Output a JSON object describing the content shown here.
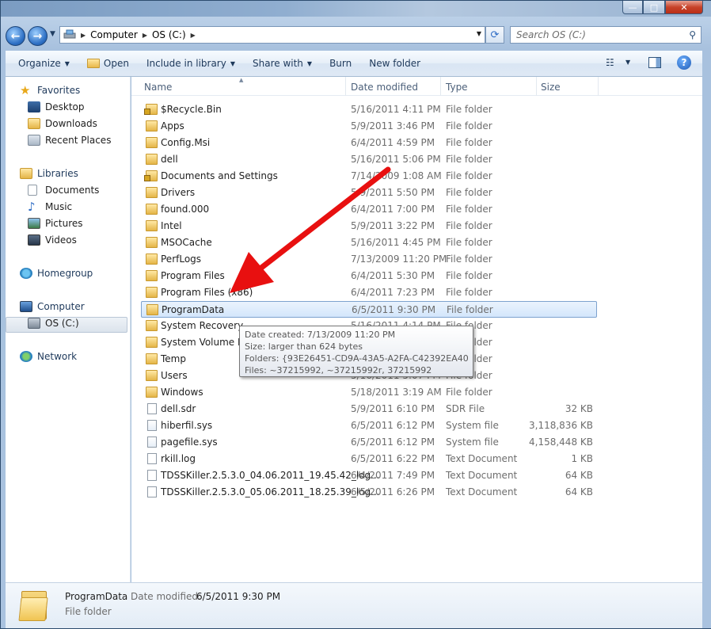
{
  "window": {
    "caption_buttons": {
      "minimize": "—",
      "maximize": "□",
      "close": "✕"
    }
  },
  "nav": {
    "back_icon": "back-arrow-icon",
    "forward_icon": "forward-arrow-icon",
    "address": {
      "segments": [
        "Computer",
        "OS (C:)"
      ]
    },
    "search": {
      "placeholder": "Search OS (C:)"
    }
  },
  "toolbar": {
    "organize": "Organize",
    "open": "Open",
    "include": "Include in library",
    "share": "Share with",
    "burn": "Burn",
    "new_folder": "New folder"
  },
  "sidebar": {
    "favorites": "Favorites",
    "desktop": "Desktop",
    "downloads": "Downloads",
    "recent": "Recent Places",
    "libraries": "Libraries",
    "documents": "Documents",
    "music": "Music",
    "pictures": "Pictures",
    "videos": "Videos",
    "homegroup": "Homegroup",
    "computer": "Computer",
    "os": "OS (C:)",
    "network": "Network"
  },
  "columns": {
    "name": "Name",
    "date": "Date modified",
    "type": "Type",
    "size": "Size"
  },
  "files": [
    {
      "name": "$Recycle.Bin",
      "date": "5/16/2011 4:11 PM",
      "type": "File folder",
      "size": "",
      "icon": "lockfolder"
    },
    {
      "name": "Apps",
      "date": "5/9/2011 3:46 PM",
      "type": "File folder",
      "size": "",
      "icon": "folder"
    },
    {
      "name": "Config.Msi",
      "date": "6/4/2011 4:59 PM",
      "type": "File folder",
      "size": "",
      "icon": "folder"
    },
    {
      "name": "dell",
      "date": "5/16/2011 5:06 PM",
      "type": "File folder",
      "size": "",
      "icon": "folder"
    },
    {
      "name": "Documents and Settings",
      "date": "7/14/2009 1:08 AM",
      "type": "File folder",
      "size": "",
      "icon": "lockfolder"
    },
    {
      "name": "Drivers",
      "date": "5/9/2011 5:50 PM",
      "type": "File folder",
      "size": "",
      "icon": "folder"
    },
    {
      "name": "found.000",
      "date": "6/4/2011 7:00 PM",
      "type": "File folder",
      "size": "",
      "icon": "folder"
    },
    {
      "name": "Intel",
      "date": "5/9/2011 3:22 PM",
      "type": "File folder",
      "size": "",
      "icon": "folder"
    },
    {
      "name": "MSOCache",
      "date": "5/16/2011 4:45 PM",
      "type": "File folder",
      "size": "",
      "icon": "folder"
    },
    {
      "name": "PerfLogs",
      "date": "7/13/2009 11:20 PM",
      "type": "File folder",
      "size": "",
      "icon": "folder"
    },
    {
      "name": "Program Files",
      "date": "6/4/2011 5:30 PM",
      "type": "File folder",
      "size": "",
      "icon": "folder"
    },
    {
      "name": "Program Files (x86)",
      "date": "6/4/2011 7:23 PM",
      "type": "File folder",
      "size": "",
      "icon": "folder"
    },
    {
      "name": "ProgramData",
      "date": "6/5/2011 9:30 PM",
      "type": "File folder",
      "size": "",
      "icon": "folder",
      "selected": true
    },
    {
      "name": "System Recovery",
      "date": "5/16/2011 4:14 PM",
      "type": "File folder",
      "size": "",
      "icon": "folder"
    },
    {
      "name": "System Volume Information",
      "date": "6/5/2011 6:11 PM",
      "type": "File folder",
      "size": "",
      "icon": "folder"
    },
    {
      "name": "Temp",
      "date": "6/4/2011 7:01 PM",
      "type": "File folder",
      "size": "",
      "icon": "folder"
    },
    {
      "name": "Users",
      "date": "5/16/2011 5:07 PM",
      "type": "File folder",
      "size": "",
      "icon": "folder"
    },
    {
      "name": "Windows",
      "date": "5/18/2011 3:19 AM",
      "type": "File folder",
      "size": "",
      "icon": "folder"
    },
    {
      "name": "dell.sdr",
      "date": "5/9/2011 6:10 PM",
      "type": "SDR File",
      "size": "32 KB",
      "icon": "file"
    },
    {
      "name": "hiberfil.sys",
      "date": "6/5/2011 6:12 PM",
      "type": "System file",
      "size": "3,118,836 KB",
      "icon": "sysfile"
    },
    {
      "name": "pagefile.sys",
      "date": "6/5/2011 6:12 PM",
      "type": "System file",
      "size": "4,158,448 KB",
      "icon": "sysfile"
    },
    {
      "name": "rkill.log",
      "date": "6/5/2011 6:22 PM",
      "type": "Text Document",
      "size": "1 KB",
      "icon": "file"
    },
    {
      "name": "TDSSKiller.2.5.3.0_04.06.2011_19.45.42_log...",
      "date": "6/4/2011 7:49 PM",
      "type": "Text Document",
      "size": "64 KB",
      "icon": "file"
    },
    {
      "name": "TDSSKiller.2.5.3.0_05.06.2011_18.25.39_log...",
      "date": "6/5/2011 6:26 PM",
      "type": "Text Document",
      "size": "64 KB",
      "icon": "file"
    }
  ],
  "tooltip": {
    "created": "Date created: 7/13/2009 11:20 PM",
    "size": "Size: larger than 624 bytes",
    "folders": "Folders: {93E26451-CD9A-43A5-A2FA-C42392EA4001}",
    "files": "Files: ~37215992, ~37215992r, 37215992"
  },
  "details": {
    "name": "ProgramData",
    "modified_label": "Date modified:",
    "modified_value": "6/5/2011 9:30 PM",
    "type": "File folder"
  },
  "colors": {
    "selection": "#d3e6fb",
    "annotation_arrow": "#e81010"
  }
}
